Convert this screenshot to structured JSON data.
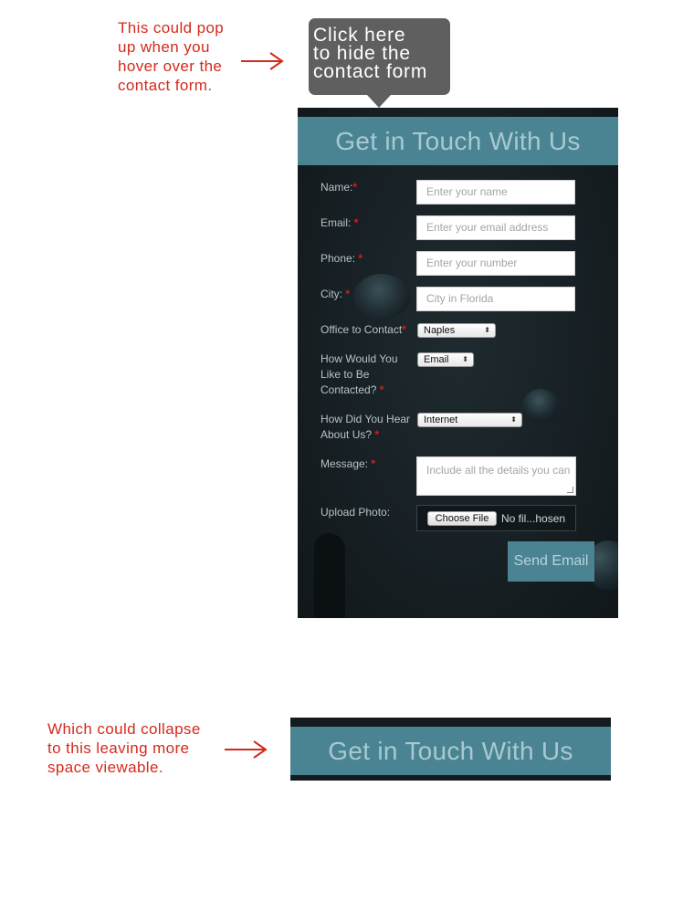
{
  "annotations": {
    "top_note": "This could pop\nup when you\nhover over the\ncontact form.",
    "bottom_note": "Which could collapse\nto this leaving more\nspace viewable.",
    "arrow_icon": "right-arrow-icon",
    "color": "#d42a1c"
  },
  "tooltip": {
    "text": "Click here\nto hide the\ncontact form",
    "color": "#5f5f5f"
  },
  "contact_form": {
    "title": "Get in Touch With Us",
    "accent": "#4a8493",
    "required_marker": "*",
    "fields": {
      "name": {
        "label": "Name:",
        "placeholder": "Enter your name"
      },
      "email": {
        "label": "Email: ",
        "placeholder": "Enter your email address"
      },
      "phone": {
        "label": "Phone: ",
        "placeholder": "Enter your number"
      },
      "city": {
        "label": "City: ",
        "placeholder": "City in Florida"
      },
      "office": {
        "label": "Office to Contact",
        "selected": "Naples"
      },
      "contact_method": {
        "label": "How Would You\nLike to Be\nContacted? ",
        "selected": "Email"
      },
      "referral": {
        "label": "How Did You Hear\nAbout Us? ",
        "selected": "Internet"
      },
      "message": {
        "label": "Message: ",
        "placeholder": "Include all the details you can"
      },
      "upload": {
        "label": "Upload Photo:",
        "button": "Choose File",
        "status": "No fil...hosen"
      }
    },
    "submit_label": "Send Email"
  },
  "collapsed_form": {
    "title": "Get in Touch With Us"
  }
}
